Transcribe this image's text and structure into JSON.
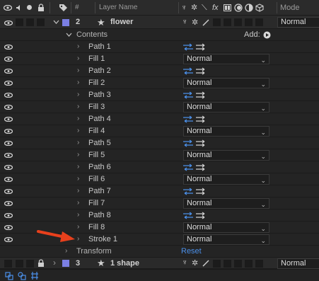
{
  "header": {
    "hash": "#",
    "layer_name": "Layer Name",
    "mode": "Mode"
  },
  "layer2": {
    "number": "2",
    "name": "flower",
    "mode": "Normal",
    "label_color": "#7b7fe3"
  },
  "contents": {
    "label": "Contents",
    "add_label": "Add:"
  },
  "items": [
    {
      "label": "Path 1",
      "kind": "path"
    },
    {
      "label": "Fill 1",
      "kind": "fill",
      "mode": "Normal"
    },
    {
      "label": "Path 2",
      "kind": "path"
    },
    {
      "label": "Fill 2",
      "kind": "fill",
      "mode": "Normal"
    },
    {
      "label": "Path 3",
      "kind": "path"
    },
    {
      "label": "Fill 3",
      "kind": "fill",
      "mode": "Normal"
    },
    {
      "label": "Path 4",
      "kind": "path"
    },
    {
      "label": "Fill 4",
      "kind": "fill",
      "mode": "Normal"
    },
    {
      "label": "Path 5",
      "kind": "path"
    },
    {
      "label": "Fill 5",
      "kind": "fill",
      "mode": "Normal"
    },
    {
      "label": "Path 6",
      "kind": "path"
    },
    {
      "label": "Fill 6",
      "kind": "fill",
      "mode": "Normal"
    },
    {
      "label": "Path 7",
      "kind": "path"
    },
    {
      "label": "Fill 7",
      "kind": "fill",
      "mode": "Normal"
    },
    {
      "label": "Path 8",
      "kind": "path"
    },
    {
      "label": "Fill 8",
      "kind": "fill",
      "mode": "Normal"
    },
    {
      "label": "Stroke 1",
      "kind": "stroke",
      "mode": "Normal"
    }
  ],
  "transform": {
    "label": "Transform",
    "reset": "Reset"
  },
  "layer3": {
    "number": "3",
    "name": "1 shape",
    "mode": "Normal",
    "label_color": "#7b7fe3"
  },
  "annotation": {
    "arrow_color": "#e8401c"
  }
}
